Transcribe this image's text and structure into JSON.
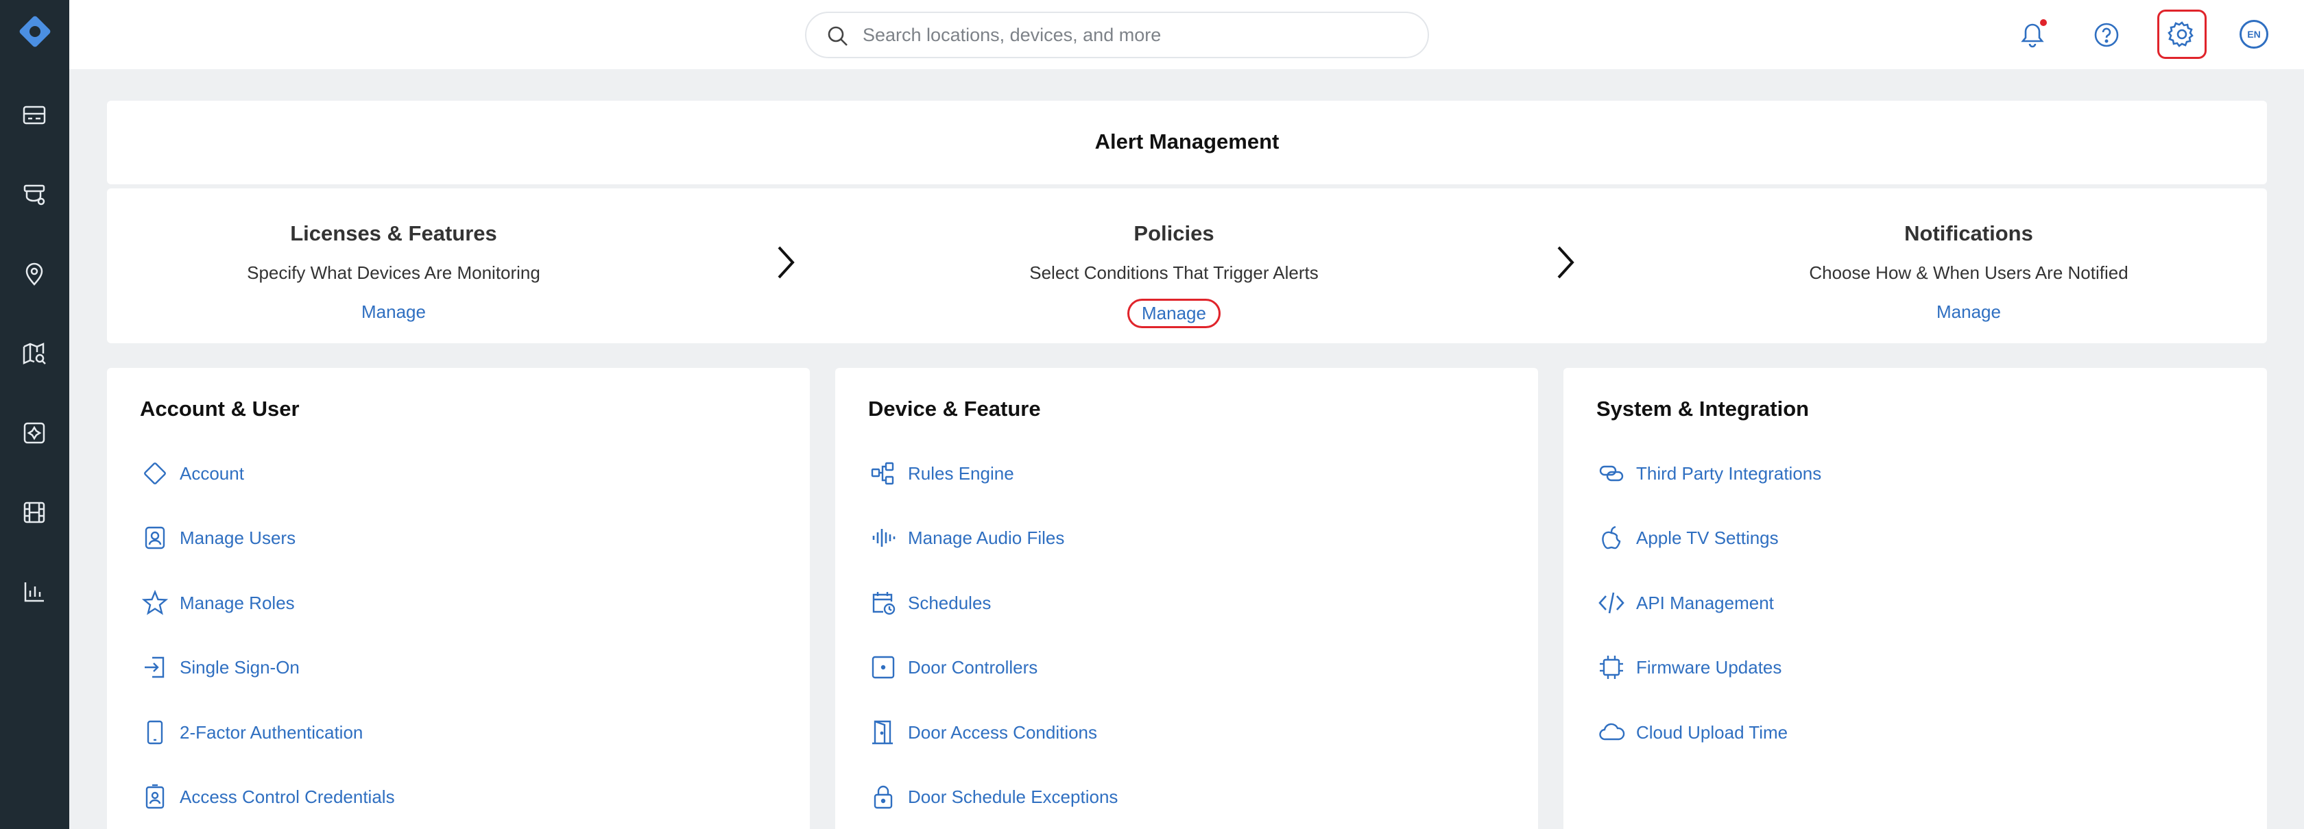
{
  "search": {
    "placeholder": "Search locations, devices, and more"
  },
  "header": {
    "language": "EN"
  },
  "alert_management": {
    "title": "Alert Management",
    "steps": [
      {
        "title": "Licenses & Features",
        "description": "Specify What Devices Are Monitoring",
        "link": "Manage"
      },
      {
        "title": "Policies",
        "description": "Select Conditions That Trigger Alerts",
        "link": "Manage"
      },
      {
        "title": "Notifications",
        "description": "Choose How & When Users Are Notified",
        "link": "Manage"
      }
    ]
  },
  "sections": [
    {
      "title": "Account & User",
      "items": [
        {
          "label": "Account",
          "icon": "diamond-icon"
        },
        {
          "label": "Manage Users",
          "icon": "user-badge-icon"
        },
        {
          "label": "Manage Roles",
          "icon": "star-icon"
        },
        {
          "label": "Single Sign-On",
          "icon": "sign-in-icon"
        },
        {
          "label": "2-Factor Authentication",
          "icon": "phone-icon"
        },
        {
          "label": "Access Control Credentials",
          "icon": "id-card-icon"
        }
      ]
    },
    {
      "title": "Device & Feature",
      "items": [
        {
          "label": "Rules Engine",
          "icon": "rules-icon"
        },
        {
          "label": "Manage Audio Files",
          "icon": "audio-wave-icon"
        },
        {
          "label": "Schedules",
          "icon": "calendar-clock-icon"
        },
        {
          "label": "Door Controllers",
          "icon": "door-controller-icon"
        },
        {
          "label": "Door Access Conditions",
          "icon": "door-icon"
        },
        {
          "label": "Door Schedule Exceptions",
          "icon": "lock-icon"
        }
      ]
    },
    {
      "title": "System & Integration",
      "items": [
        {
          "label": "Third Party Integrations",
          "icon": "link-icon"
        },
        {
          "label": "Apple TV Settings",
          "icon": "apple-icon"
        },
        {
          "label": "API Management",
          "icon": "code-icon"
        },
        {
          "label": "Firmware Updates",
          "icon": "chip-icon"
        },
        {
          "label": "Cloud Upload Time",
          "icon": "cloud-icon"
        }
      ]
    }
  ],
  "colors": {
    "accent": "#2f6fc1",
    "sidebar": "#1f2b33",
    "highlight": "#e0242b",
    "background": "#eef0f2"
  }
}
